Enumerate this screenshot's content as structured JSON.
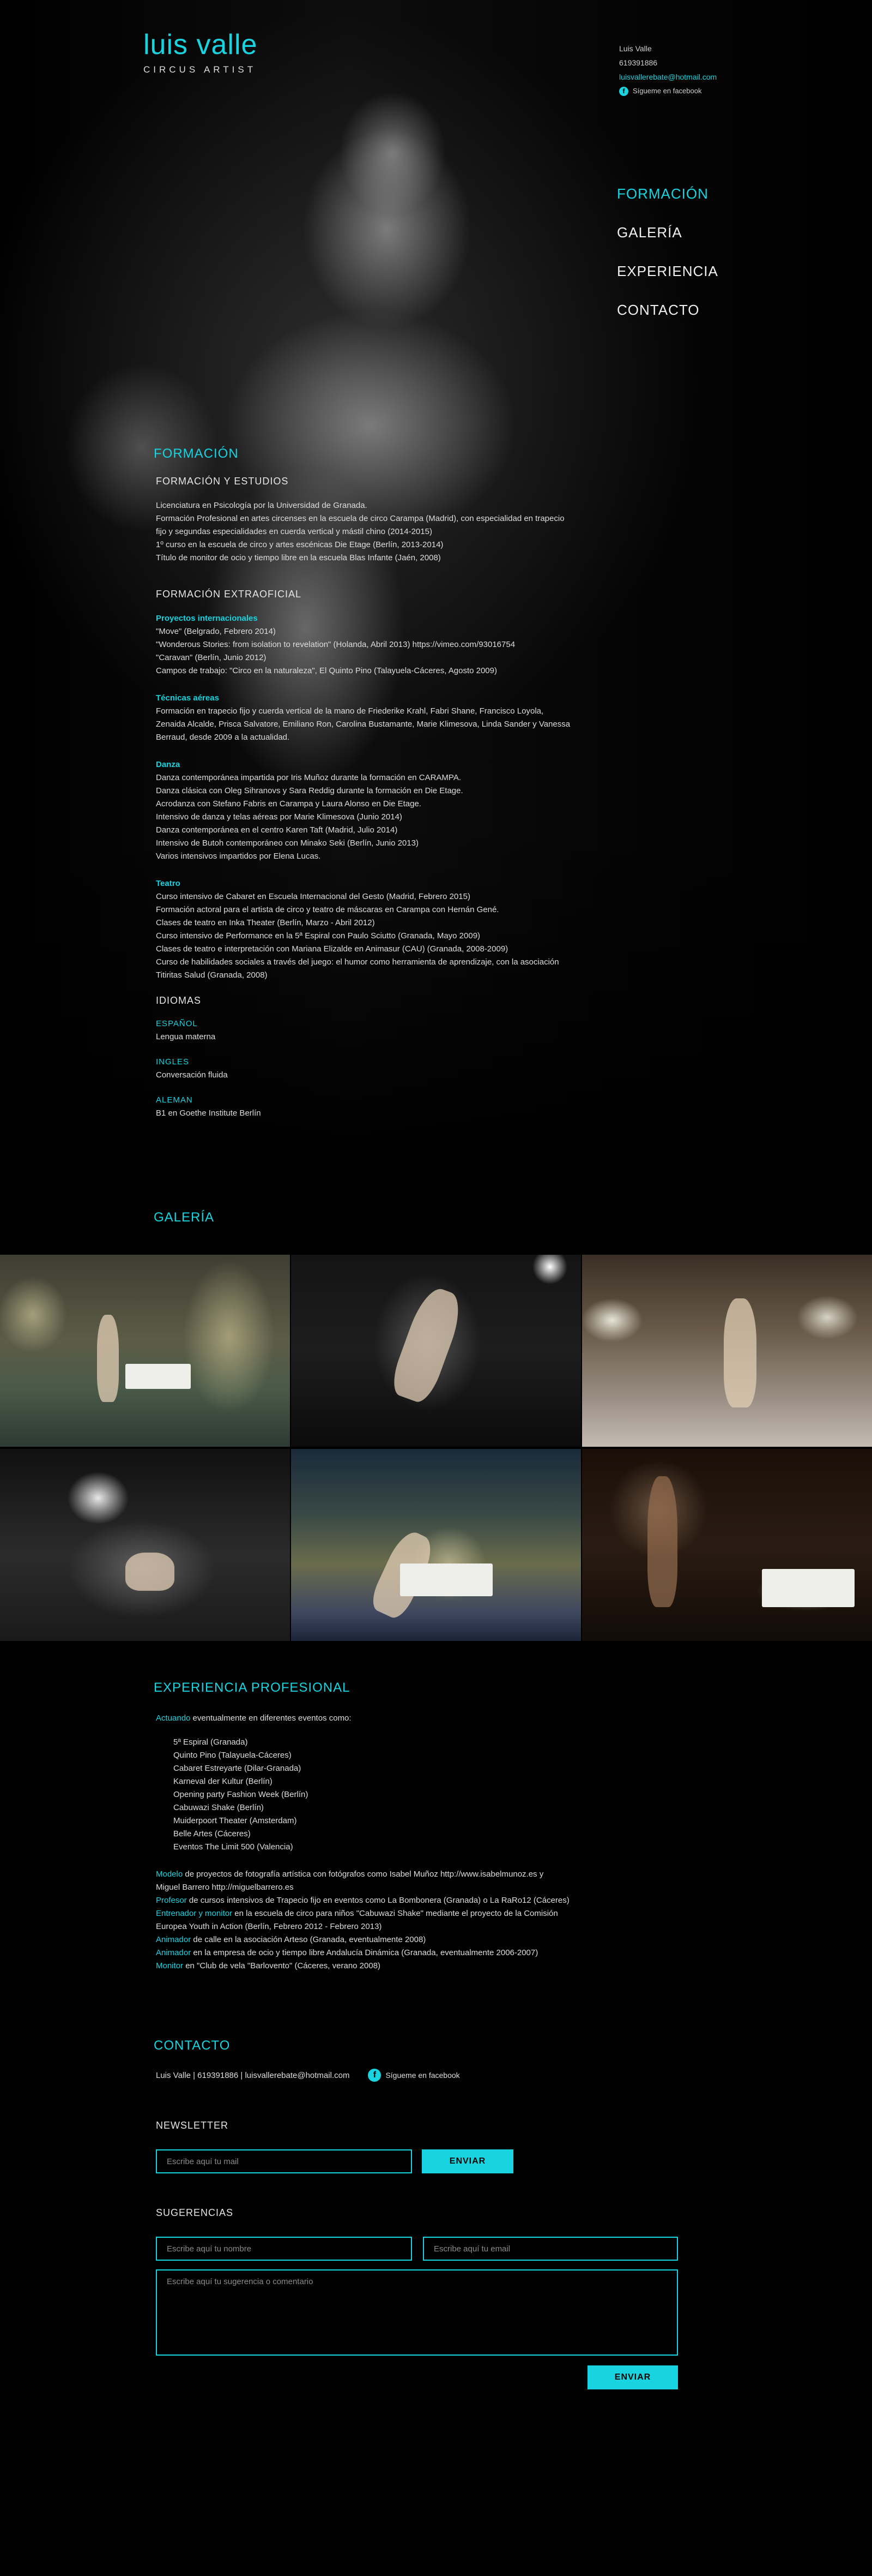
{
  "header": {
    "logo_name": "luis valle",
    "logo_sub": "CIRCUS ARTIST",
    "contact_name": "Luis Valle",
    "contact_phone": "619391886",
    "contact_email": "luisvallerebate@hotmail.com",
    "facebook_label": "Sígueme en facebook"
  },
  "nav": [
    "FORMACIÓN",
    "GALERÍA",
    "EXPERIENCIA",
    "CONTACTO"
  ],
  "formacion": {
    "title": "FORMACIÓN",
    "estudios_title": "FORMACIÓN Y ESTUDIOS",
    "estudios": [
      "Licenciatura en Psicología por la Universidad de Granada.",
      "Formación Profesional en artes circenses en la escuela de circo Carampa (Madrid), con especialidad en trapecio",
      "fijo y segundas especialidades en cuerda vertical y mástil chino (2014-2015)",
      "1º curso en la escuela de circo y artes escénicas Die Etage (Berlín, 2013-2014)",
      "Título de monitor de ocio y tiempo libre en la escuela Blas Infante (Jaén, 2008)"
    ],
    "extra_title": "FORMACIÓN EXTRAOFICIAL",
    "proyectos_title": "Proyectos internacionales",
    "proyectos": [
      "\"Move\" (Belgrado, Febrero 2014)",
      "\"Wonderous Stories: from isolation to revelation\" (Holanda, Abril 2013) https://vimeo.com/93016754",
      "\"Caravan\" (Berlín, Junio 2012)",
      "Campos de trabajo: \"Circo en la naturaleza\", El Quinto Pino (Talayuela-Cáceres, Agosto 2009)"
    ],
    "tecnicas_title": "Técnicas aéreas",
    "tecnicas": [
      "Formación en trapecio fijo y cuerda vertical de la mano de Friederike Krahl, Fabri Shane, Francisco Loyola,",
      "Zenaida Alcalde, Prisca Salvatore, Emiliano Ron, Carolina Bustamante, Marie Klimesova, Linda Sander y Vanessa",
      "Berraud, desde 2009 a la actualidad."
    ],
    "danza_title": "Danza",
    "danza": [
      "Danza contemporánea impartida por Iris Muñoz durante la formación en CARAMPA.",
      "Danza clásica con Oleg Sihranovs y Sara Reddig durante la formación en Die Etage.",
      "Acrodanza con Stefano Fabris en Carampa y Laura Alonso en Die Etage.",
      "Intensivo de danza y telas aéreas por Marie Klimesova (Junio 2014)",
      "Danza contemporánea en el centro Karen Taft (Madrid, Julio 2014)",
      "Intensivo de Butoh contemporáneo con Minako Seki (Berlín, Junio 2013)",
      "Varios intensivos impartidos por Elena Lucas."
    ],
    "teatro_title": "Teatro",
    "teatro": [
      "Curso intensivo de Cabaret en Escuela Internacional del Gesto (Madrid, Febrero 2015)",
      "Formación actoral para el artista de circo y teatro de máscaras en Carampa con Hernán Gené.",
      "Clases de teatro en Inka Theater (Berlín, Marzo - Abril 2012)",
      "Curso intensivo de Performance en la 5ª Espiral con Paulo Sciutto (Granada, Mayo 2009)",
      "Clases de teatro e interpretación con Mariana Elizalde en Animasur (CAU) (Granada, 2008-2009)",
      "Curso de habilidades sociales a través del juego: el humor como herramienta de aprendizaje, con la asociación",
      "Titiritas Salud (Granada, 2008)"
    ],
    "idiomas_title": "IDIOMAS",
    "idiomas": [
      {
        "lang": "ESPAÑOL",
        "level": "Lengua materna"
      },
      {
        "lang": "INGLES",
        "level": "Conversación fluida"
      },
      {
        "lang": "ALEMAN",
        "level": "B1 en Goethe Institute Berlín"
      }
    ]
  },
  "galeria": {
    "title": "GALERÍA"
  },
  "experiencia": {
    "title": "EXPERIENCIA PROFESIONAL",
    "intro_hl": "Actuando",
    "intro_rest": " eventualmente en diferentes eventos como:",
    "eventos": [
      "5ª Espiral (Granada)",
      "Quinto Pino (Talayuela-Cáceres)",
      "Cabaret Estreyarte (Dilar-Granada)",
      "Karneval der Kultur (Berlín)",
      "Opening party Fashion Week (Berlín)",
      "Cabuwazi Shake (Berlín)",
      "Muiderpoort Theater (Amsterdam)",
      "Belle Artes (Cáceres)",
      "Eventos The Limit 500 (Valencia)"
    ],
    "roles": [
      {
        "hl": "Modelo",
        "rest": " de proyectos de fotografía artística con fotógrafos como Isabel Muñoz http://www.isabelmunoz.es y"
      },
      {
        "hl": "",
        "rest": "Miguel Barrero http://miguelbarrero.es"
      },
      {
        "hl": "Profesor",
        "rest": " de cursos intensivos de Trapecio fijo en eventos como La Bombonera (Granada) o La RaRo12 (Cáceres)"
      },
      {
        "hl": "Entrenador y monitor",
        "rest": " en la escuela de circo para niños \"Cabuwazi Shake\" mediante el proyecto de la Comisión"
      },
      {
        "hl": "",
        "rest": "Europea Youth in Action (Berlín, Febrero 2012 - Febrero 2013)"
      },
      {
        "hl": "Animador",
        "rest": " de calle en la asociación Arteso (Granada, eventualmente 2008)"
      },
      {
        "hl": "Animador",
        "rest": " en la empresa de ocio y tiempo libre Andalucía Dinámica (Granada, eventualmente 2006-2007)"
      },
      {
        "hl": "Monitor",
        "rest": " en \"Club de vela \"Barlovento\" (Cáceres, verano 2008)"
      }
    ]
  },
  "contacto": {
    "title": "CONTACTO",
    "line": "Luis Valle | 619391886 | luisvallerebate@hotmail.com",
    "facebook_label": "Sígueme en facebook",
    "newsletter_title": "NEWSLETTER",
    "newsletter_placeholder": "Escribe aquí tu mail",
    "send_label": "ENVIAR",
    "sugerencias_title": "SUGERENCIAS",
    "name_placeholder": "Escribe aquí tu nombre",
    "email_placeholder": "Escribe aquí tu email",
    "message_placeholder": "Escribe aquí tu sugerencia o comentario",
    "send_label_2": "ENVIAR"
  },
  "colors": {
    "accent": "#17d4e0",
    "background": "#000000",
    "text": "#e6e6e6"
  }
}
